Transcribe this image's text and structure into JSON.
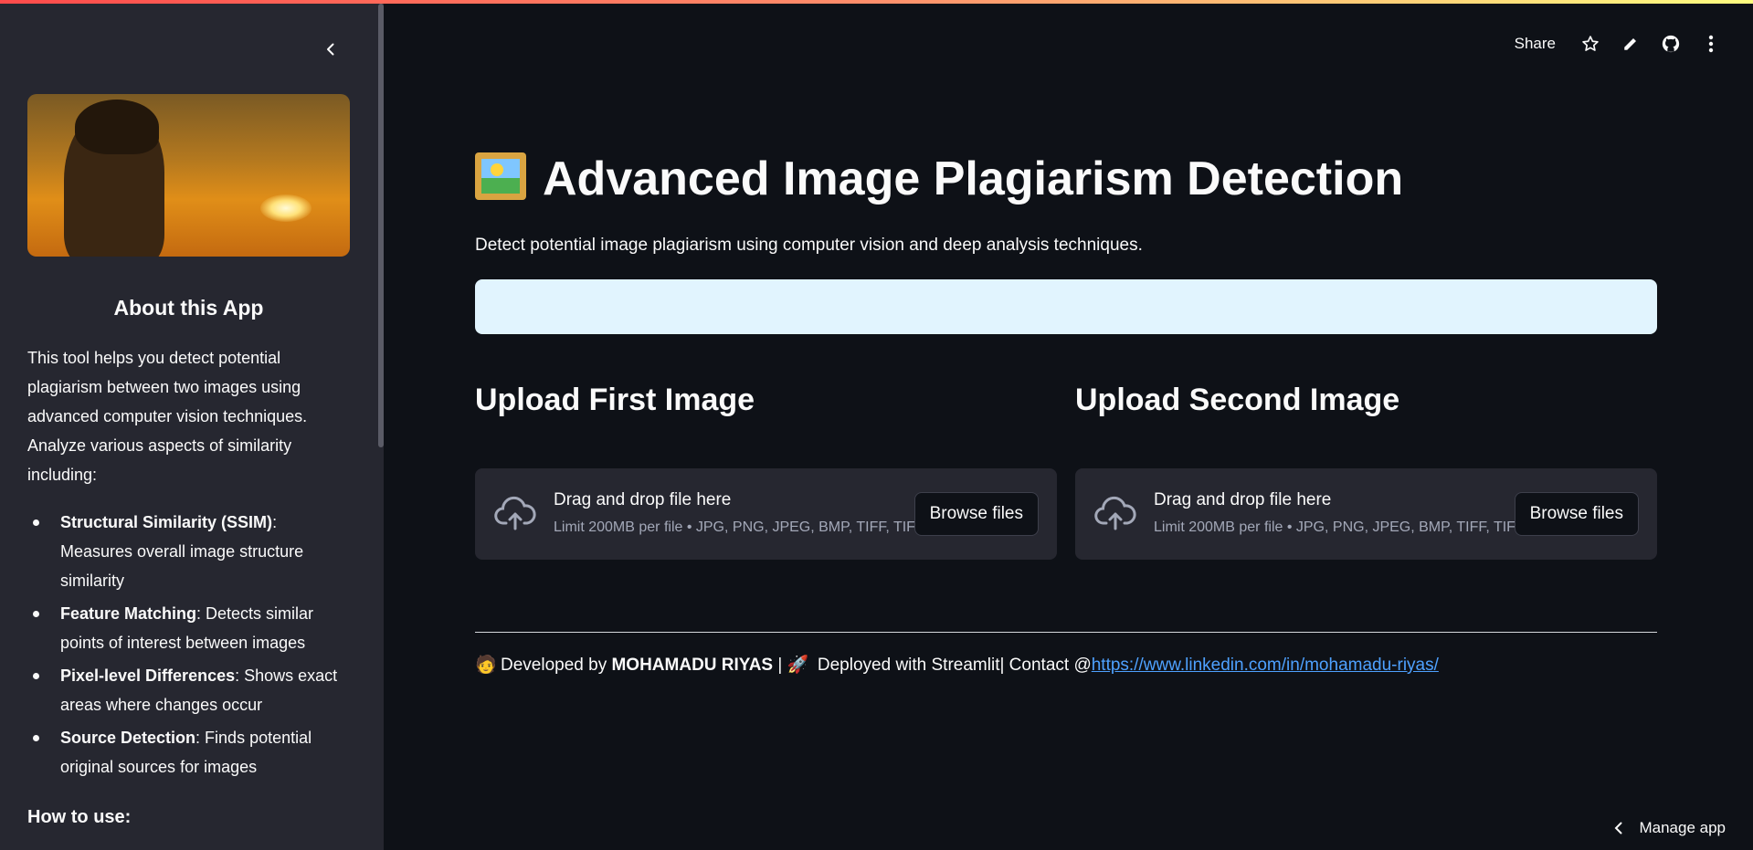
{
  "sidebar": {
    "collapse_icon": "chevron-left-icon",
    "about_title": "About this App",
    "about_text": "This tool helps you detect potential plagiarism between two images using advanced computer vision techniques. Analyze various aspects of similarity including:",
    "features": [
      {
        "name": "Structural Similarity (SSIM)",
        "desc": ": Measures overall image structure similarity"
      },
      {
        "name": "Feature Matching",
        "desc": ": Detects similar points of interest between images"
      },
      {
        "name": "Pixel-level Differences",
        "desc": ": Shows exact areas where changes occur"
      },
      {
        "name": "Source Detection",
        "desc": ": Finds potential original sources for images"
      }
    ],
    "how_to_title": "How to use:"
  },
  "header": {
    "share_label": "Share",
    "icons": [
      "star-icon",
      "pencil-icon",
      "github-icon",
      "more-vertical-icon"
    ]
  },
  "main": {
    "title": "Advanced Image Plagiarism Detection",
    "title_icon": "framed-picture-emoji",
    "subtitle": "Detect potential image plagiarism using computer vision and deep analysis techniques.",
    "uploads": [
      {
        "heading": "Upload First Image",
        "dz_title": "Drag and drop file here",
        "dz_limit": "Limit 200MB per file • JPG, PNG, JPEG, BMP, TIFF, TIF",
        "button": "Browse files"
      },
      {
        "heading": "Upload Second Image",
        "dz_title": "Drag and drop file here",
        "dz_limit": "Limit 200MB per file • JPG, PNG, JPEG, BMP, TIFF, TIF",
        "button": "Browse files"
      }
    ],
    "footer": {
      "part1": "Developed by ",
      "author": "MOHAMADU RIYAS",
      "part2": " | ",
      "part3": " Deployed with Streamlit| Contact @",
      "link": "https://www.linkedin.com/in/mohamadu-riyas/"
    }
  },
  "manage_app_label": "Manage app",
  "colors": {
    "background": "#0e1117",
    "sidebar": "#262730",
    "info_box": "#e1f4fe",
    "link": "#4ea1ff"
  }
}
